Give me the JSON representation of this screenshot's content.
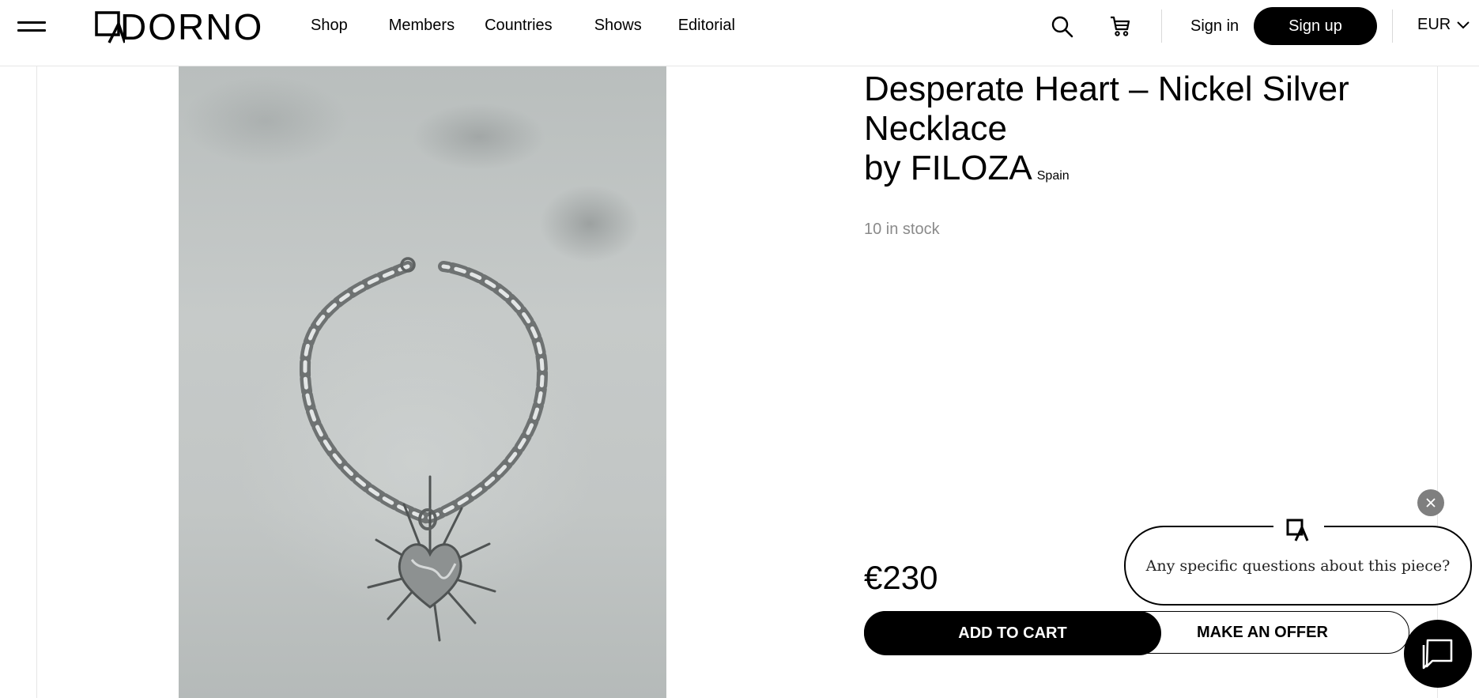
{
  "header": {
    "menu_icon": "hamburger-menu-icon",
    "logo_text": "ADORNO",
    "nav": [
      "Shop",
      "Members",
      "Countries",
      "Shows",
      "Editorial"
    ],
    "search_icon": "search-icon",
    "cart_icon": "cart-icon",
    "signin_label": "Sign in",
    "signup_label": "Sign up",
    "currency": "EUR"
  },
  "product": {
    "title": "Desperate Heart – Nickel Silver Necklace",
    "by_prefix": "by",
    "designer": "FILOZA",
    "country": "Spain",
    "stock": "10 in stock",
    "price": "€230",
    "add_to_cart_label": "ADD TO CART",
    "make_offer_label": "MAKE AN OFFER",
    "image_alt": "necklace-photo"
  },
  "chat": {
    "prompt": "Any specific questions about this piece?",
    "close_icon": "close-icon",
    "launcher_icon": "chat-icon"
  },
  "colors": {
    "accent": "#000000",
    "muted_text": "#8a8a8a",
    "close_bg": "#7f7f7f"
  }
}
